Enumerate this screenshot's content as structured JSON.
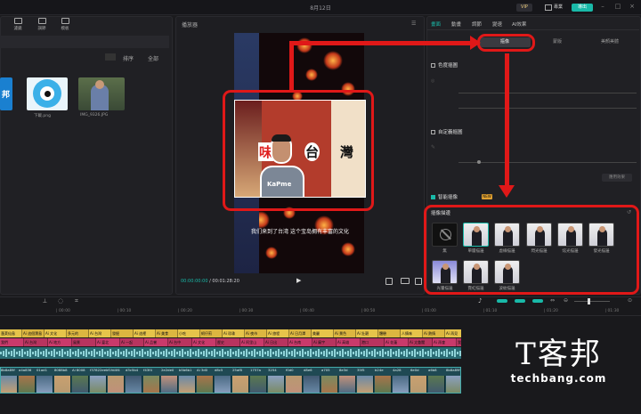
{
  "window": {
    "title": "8月12日",
    "vip_label": "VIP",
    "project_label": "專業",
    "export_label": "導出",
    "min_icon": "minimize-icon",
    "max_icon": "maximize-icon",
    "close_icon": "close-icon"
  },
  "media": {
    "tools": [
      {
        "label": "濾鏡",
        "icon": "filter-icon"
      },
      {
        "label": "調節",
        "icon": "adjust-icon"
      },
      {
        "label": "模板",
        "icon": "template-icon"
      }
    ],
    "sort_label": "排序",
    "all_label": "全部",
    "files": [
      {
        "name": "",
        "bg": "#1a80d0"
      },
      {
        "name": "下載.png",
        "bg": "#3bb0e8"
      },
      {
        "name": "IMG_9326.JPG",
        "bg": "#5b6f4a"
      }
    ]
  },
  "player": {
    "title": "播放器",
    "overlay_chars": [
      "味",
      "台",
      "灣"
    ],
    "shirt_text": "KaPme",
    "subtitle": "我们来到了台湾 这个宝岛拥有丰富的文化",
    "time_current": "00:00:00:00",
    "time_total": "00:01:28:20"
  },
  "props": {
    "tabs": [
      "畫面",
      "動畫",
      "調節",
      "變速",
      "AI效果"
    ],
    "subtabs": [
      "摳像",
      "蒙版",
      "美顏美體"
    ],
    "active_subtab": 0,
    "sections": {
      "chroma": "色度摳圖",
      "custom": "自定義摳圖",
      "smart": "智能摳像",
      "smart_badge": "NEW",
      "stroke": "摳像描邊",
      "apply_label": "應用效果"
    },
    "presets": [
      {
        "label": "無",
        "none": true
      },
      {
        "label": "單層描邊"
      },
      {
        "label": "虛線描邊"
      },
      {
        "label": "閃光描邊"
      },
      {
        "label": "炫光描邊"
      },
      {
        "label": "發光描邊"
      },
      {
        "label": "光暈描邊"
      },
      {
        "label": "霓虹描邊"
      },
      {
        "label": "波紋描邊"
      }
    ]
  },
  "timeline": {
    "ticks": [
      "00:00",
      "00:10",
      "00:20",
      "00:30",
      "00:40",
      "00:50",
      "01:00",
      "01:10",
      "01:20",
      "01:30"
    ],
    "text_chips_1": [
      "蓬萊仙島",
      "Ai 這個寶島",
      "Ai 文化",
      "多元的",
      "Ai 台灣",
      "發掘",
      "Ai 這裡",
      "Ai 美食",
      "小吃",
      "蚵仔煎",
      "Ai 珍珠",
      "Ai 夜市",
      "Ai 旅程",
      "Ai 日月潭",
      "美麗",
      "Ai 景色",
      "Ai 壯觀",
      "體驗",
      "人情味",
      "Ai 熱情",
      "Ai 再見"
    ],
    "text_chips_2": [
      "我們",
      "Ai 台灣",
      "Ai 地方",
      "風景",
      "Ai 臺北",
      "Ai 一起",
      "Ai 品嘗",
      "Ai 台中",
      "Ai 文化",
      "歷史",
      "Ai 阿里山",
      "Ai 日出",
      "Ai 台南",
      "Ai 廟宇",
      "Ai 高雄",
      "港口",
      "Ai 花蓮",
      "Ai 太魯閣",
      "Ai 再會"
    ],
    "video_labels": [
      "8b8a89f",
      "a4a836",
      "01ad1",
      "8088b8",
      "Ai 8008",
      "f37822eeb",
      "f1fd4f4",
      "d3c5b4",
      "f43f4",
      "2e2de0",
      "b5b6b1",
      "Ai 3d0",
      "d8c5",
      "25af8",
      "1757a",
      "3254",
      "f0d0",
      "d8e6",
      "a705",
      "8e3d",
      "35f5",
      "b24e",
      "4a28",
      "6e0d",
      "a6b8"
    ]
  },
  "watermark": {
    "cn": "T客邦",
    "en": "techbang.com"
  }
}
